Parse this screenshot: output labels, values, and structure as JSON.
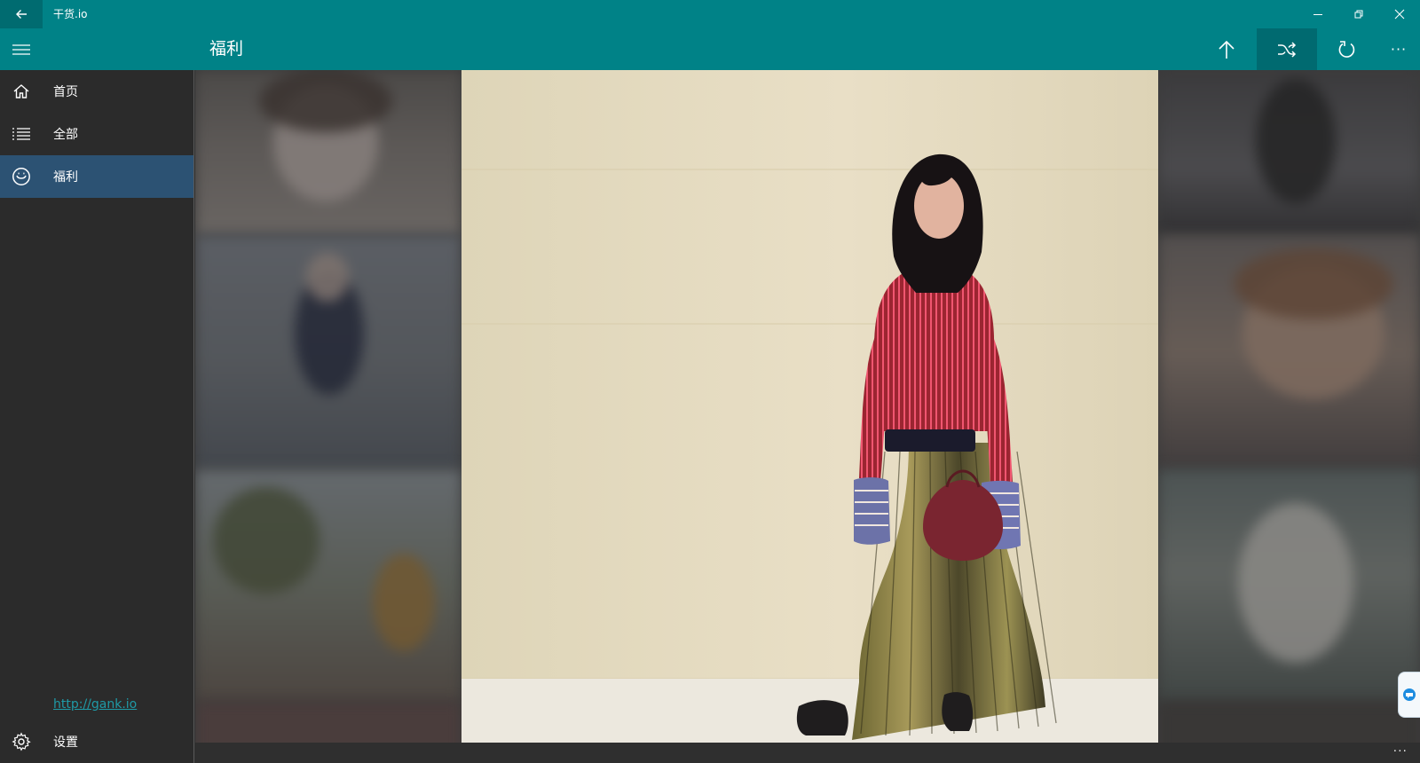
{
  "window": {
    "app_title": "干货.io"
  },
  "header": {
    "page_title": "福利"
  },
  "sidebar": {
    "items": [
      {
        "label": "首页",
        "icon": "home-icon"
      },
      {
        "label": "全部",
        "icon": "list-icon"
      },
      {
        "label": "福利",
        "icon": "smile-icon",
        "selected": true
      }
    ],
    "link": "http://gank.io",
    "settings_label": "设置"
  },
  "toolbar": {
    "more_label": "···"
  },
  "bottom": {
    "more_label": "···"
  },
  "colors": {
    "accent": "#008287",
    "selection": "#2c5273",
    "sidebar_bg": "#2b2b2b",
    "link": "#1f9aa6"
  }
}
